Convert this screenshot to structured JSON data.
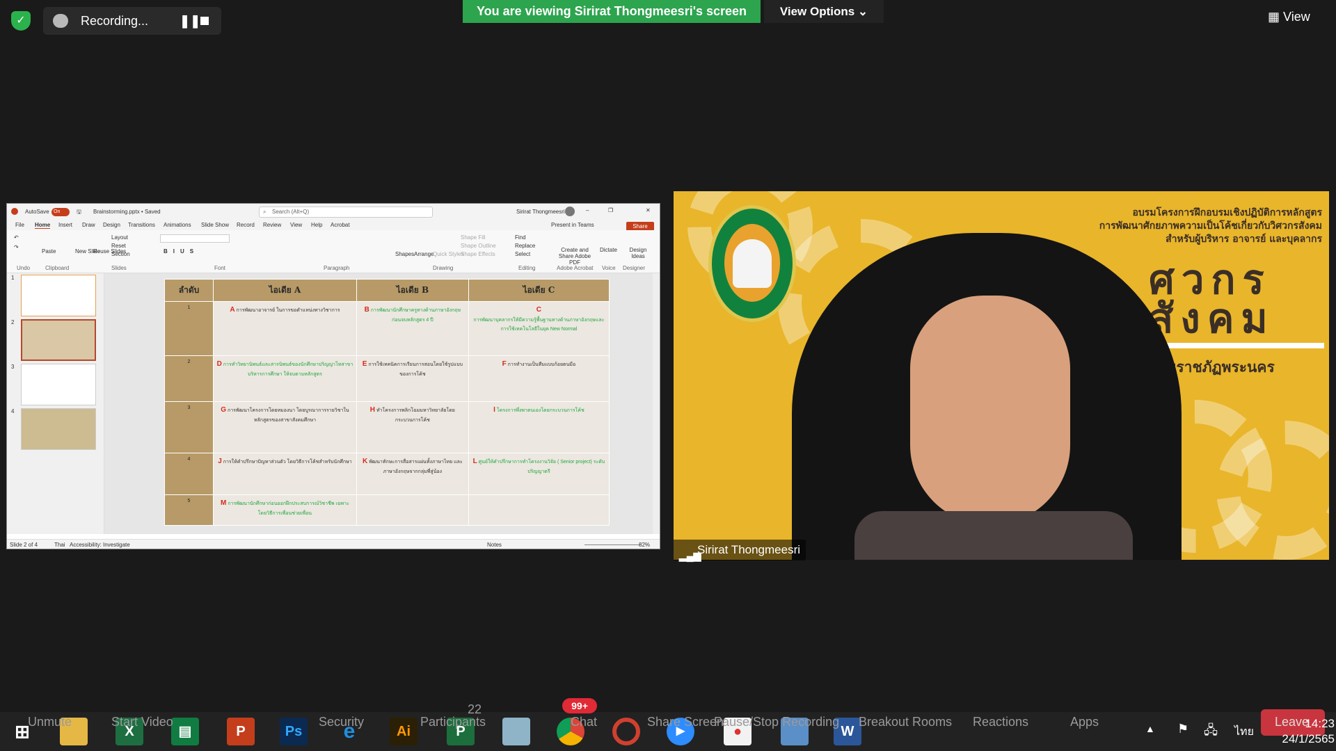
{
  "top_bar": {
    "recording_label": "Recording...",
    "viewing_banner": "You are viewing Sirirat Thongmeesri's screen",
    "view_options_label": "View Options",
    "view_label": "View"
  },
  "ppt": {
    "autosave": "AutoSave",
    "autosave_state": "On",
    "filename": "Brainstorming.pptx • Saved",
    "search_placeholder": "Search (Alt+Q)",
    "user": "Sirirat Thongmeesri",
    "menu": [
      "File",
      "Home",
      "Insert",
      "Draw",
      "Design",
      "Transitions",
      "Animations",
      "Slide Show",
      "Record",
      "Review",
      "View",
      "Help",
      "Acrobat"
    ],
    "present_in_teams": "Present in Teams",
    "share": "Share",
    "ribbon_groups": [
      "Undo",
      "Clipboard",
      "Slides",
      "Font",
      "Paragraph",
      "Drawing",
      "Editing",
      "Adobe Acrobat",
      "Voice",
      "Designer"
    ],
    "ribbon_items": {
      "paste": "Paste",
      "new_slide": "New Slide",
      "reuse_slides": "Reuse Slides",
      "layout": "Layout",
      "reset": "Reset",
      "section": "Section",
      "shapes": "Shapes",
      "arrange": "Arrange",
      "quick_styles": "Quick Styles",
      "shape_fill": "Shape Fill",
      "shape_outline": "Shape Outline",
      "shape_effects": "Shape Effects",
      "find": "Find",
      "replace": "Replace",
      "select": "Select",
      "create_share_pdf": "Create and Share Adobe PDF",
      "dictate": "Dictate",
      "design_ideas": "Design Ideas"
    },
    "thumb_numbers": [
      "1",
      "2",
      "3",
      "4"
    ],
    "status": {
      "slide": "Slide 2 of 4",
      "language": "Thai",
      "accessibility": "Accessibility: Investigate",
      "notes": "Notes",
      "zoom": "82%"
    },
    "table": {
      "headers": [
        "ลำดับ",
        "ไอเดีย A",
        "ไอเดีย B",
        "ไอเดีย C"
      ],
      "rows": [
        {
          "num": "1",
          "a_letter": "A",
          "a": "การพัฒนาอาจารย์ ในการขอตำแหน่งทางวิชาการ",
          "b_letter": "B",
          "b": "การพัฒนานักศึกษาครูทางด้านภาษาอังกฤษ ก่อนจบหลักสูตร 4 ปี",
          "c_letter": "C",
          "c": "การพัฒนาบุคลากรให้มีความรู้พื้นฐานทางด้านภาษาอังกฤษและการใช้เทคโนโลยีในยุค New Normal"
        },
        {
          "num": "2",
          "a_letter": "D",
          "a": "การทำวิทยานิพนธ์และสารนิพนธ์ของนักศึกษาปริญญาโทสาขาบริหารการศึกษา ให้จบตามหลักสูตร",
          "b_letter": "E",
          "b": "การใช้เทคนิคการเรียนการสอนโดยใช้รูปแบบของการโค้ช",
          "c_letter": "F",
          "c": "การทำงานเป็นทีมแบบก้อยตนมือ"
        },
        {
          "num": "3",
          "a_letter": "G",
          "a": "การพัฒนาโครงการโดยหมองนา โดยบูรณาการรายวิชาในหลักสูตรของสาขาสังคมศึกษา",
          "b_letter": "H",
          "b": "ทำโครงการพลิกโฉมมหาวิทยาลัยโดยกระบวนการโค้ช",
          "c_letter": "I",
          "c": "โครงการพึ่งพาตนเองโดยกระบวนการโค้ช"
        },
        {
          "num": "4",
          "a_letter": "J",
          "a": "การให้คำปรึกษาปัญหาส่วนตัว โดยวิธีการโค้ชสำหรับนักศึกษา",
          "b_letter": "K",
          "b": "พัฒนาทักษะการสื่อสารแผ่นทั้งภาษาไทย และภาษาอังกฤษจากกลุ่มพี่สู่น้อง",
          "c_letter": "L",
          "c": "ศูนย์ให้คำปรึกษาการทำโครงงานวิจัย ( Senior project) ระดับปริญญาตรี"
        },
        {
          "num": "5",
          "a_letter": "M",
          "a": "การพัฒนานักศึกษาก่อนออกฝึกประสบการณ์วิชาชีพ เฉพาะโดยวิธีการเพื่อนช่วยเพื่อน",
          "b_letter": "",
          "b": "",
          "c_letter": "",
          "c": ""
        }
      ]
    }
  },
  "camera": {
    "header_line1": "อบรมโครงการฝึกอบรมเชิงปฏิบัติการหลักสูตร",
    "header_line2": "การพัฒนาศักยภาพความเป็นโค้ชเกี่ยวกับวิศวกรสังคม",
    "header_line3": "สำหรับผู้บริหาร อาจารย์ และบุคลากร",
    "big_char": "ว",
    "big_line1": "ศวกร",
    "big_line2": "สังคม",
    "university": "มหาวิทยาลัยราชภัฏพระนคร",
    "participant_name": "Sirirat Thongmeesri"
  },
  "taskbar": {
    "zoom_labels": [
      "Unmute",
      "Start Video",
      "Security",
      "Participants",
      "Chat",
      "Share Screen",
      "Pause/Stop Recording",
      "Breakout Rooms",
      "Reactions",
      "Apps",
      "Leave"
    ],
    "participants_count": "22",
    "chat_badge": "99+",
    "app_icons": [
      "windows-start-icon",
      "file-explorer-icon",
      "excel-icon",
      "publisher-green-icon",
      "powerpoint-icon",
      "photoshop-icon",
      "internet-explorer-icon",
      "illustrator-icon",
      "project-icon",
      "notes-icon",
      "chrome-icon",
      "hotcape-icon",
      "zoom-icon",
      "presenter-icon",
      "remote-desktop-icon",
      "word-icon"
    ],
    "lang": "ไทย",
    "time": "14:23",
    "date": "24/1/2565"
  },
  "colors": {
    "zoom_green": "#2da44e",
    "table_header": "#b79a67",
    "accent_red": "#d42a1e",
    "accent_green": "#1fa63f",
    "ppt_red": "#c43e1c",
    "camera_bg": "#e9b52a"
  }
}
